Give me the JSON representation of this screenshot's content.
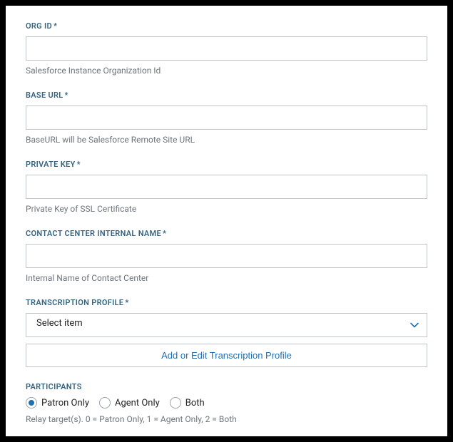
{
  "fields": {
    "org_id": {
      "label": "ORG ID",
      "required": "*",
      "value": "",
      "help": "Salesforce Instance Organization Id"
    },
    "base_url": {
      "label": "BASE URL",
      "required": "*",
      "value": "",
      "help": "BaseURL will be Salesforce Remote Site URL"
    },
    "private_key": {
      "label": "PRIVATE KEY",
      "required": "*",
      "value": "",
      "help": "Private Key of SSL Certificate"
    },
    "contact_center": {
      "label": "CONTACT CENTER INTERNAL NAME",
      "required": "*",
      "value": "",
      "help": "Internal Name of Contact Center"
    },
    "transcription_profile": {
      "label": "TRANSCRIPTION PROFILE",
      "required": "*",
      "selected": "Select item",
      "button": "Add or Edit Transcription Profile"
    },
    "participants": {
      "label": "PARTICIPANTS",
      "options": {
        "patron": "Patron Only",
        "agent": "Agent Only",
        "both": "Both"
      },
      "selected": "patron",
      "help": "Relay target(s). 0 = Patron Only, 1 = Agent Only, 2 = Both"
    }
  }
}
